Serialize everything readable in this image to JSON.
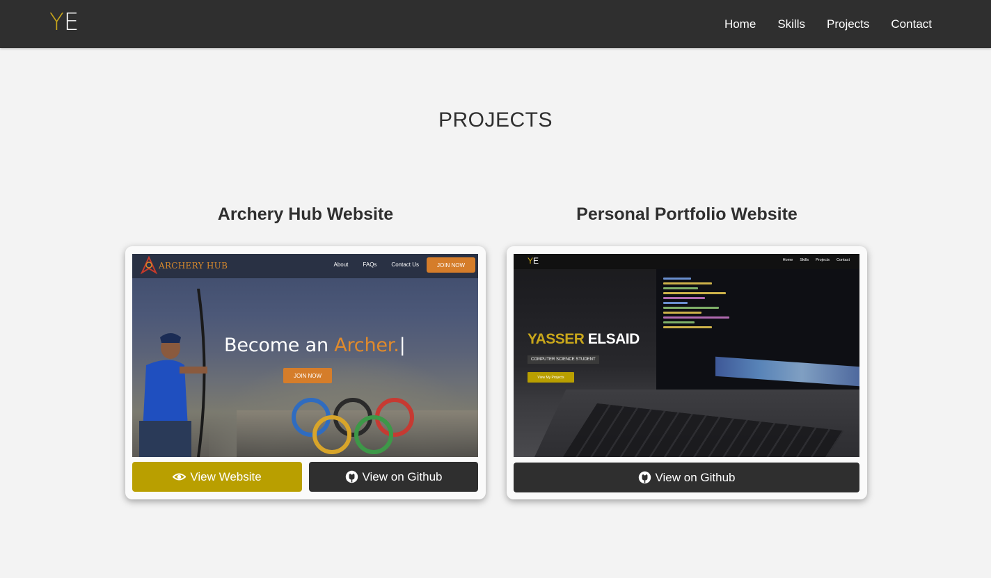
{
  "header": {
    "logo_y": "Y",
    "logo_e": "E",
    "nav": [
      "Home",
      "Skills",
      "Projects",
      "Contact"
    ]
  },
  "section": {
    "title": "PROJECTS"
  },
  "projects": [
    {
      "title": "Archery Hub Website",
      "preview": {
        "logo_text": "ARCHERY HUB",
        "nav": [
          "About",
          "FAQs",
          "Contact Us"
        ],
        "join_top": "JOIN NOW",
        "headline_pre": "Become an ",
        "headline_accent": "Archer.",
        "cursor": "|",
        "join_mid": "JOIN NOW"
      },
      "view_label": "View Website",
      "github_label": "View on Github"
    },
    {
      "title": "Personal Portfolio Website",
      "preview": {
        "logo_y": "Y",
        "logo_e": "E",
        "nav": [
          "Home",
          "Skills",
          "Projects",
          "Contact"
        ],
        "first_name": "YASSER",
        "last_name": "ELSAID",
        "subtitle": "COMPUTER SCIENCE STUDENT",
        "button": "View My Projects"
      },
      "github_label": "View on Github"
    }
  ],
  "colors": {
    "accent": "#b99f00",
    "nav_bg": "#2f2f2f",
    "page_bg": "#f3f3f3",
    "logo_y": "#c9a71b"
  },
  "icons": {
    "view": "eye-icon",
    "github": "github-icon"
  }
}
